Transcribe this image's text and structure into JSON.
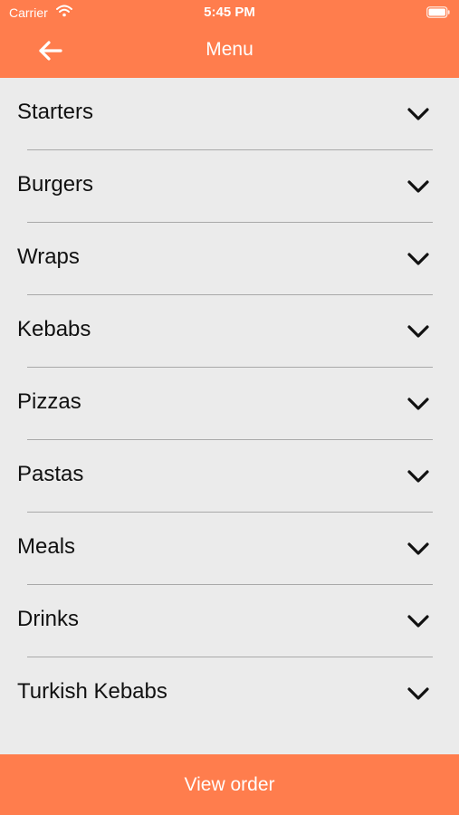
{
  "status_bar": {
    "carrier": "Carrier",
    "time": "5:45 PM",
    "wifi_icon": "wifi-icon",
    "battery_icon": "battery-icon"
  },
  "header": {
    "title": "Menu",
    "back_icon": "arrow-left-icon"
  },
  "menu": {
    "items": [
      {
        "label": "Starters",
        "icon": "chevron-down-icon"
      },
      {
        "label": "Burgers",
        "icon": "chevron-down-icon"
      },
      {
        "label": "Wraps",
        "icon": "chevron-down-icon"
      },
      {
        "label": "Kebabs",
        "icon": "chevron-down-icon"
      },
      {
        "label": "Pizzas",
        "icon": "chevron-down-icon"
      },
      {
        "label": "Pastas",
        "icon": "chevron-down-icon"
      },
      {
        "label": "Meals",
        "icon": "chevron-down-icon"
      },
      {
        "label": "Drinks",
        "icon": "chevron-down-icon"
      },
      {
        "label": "Turkish Kebabs",
        "icon": "chevron-down-icon"
      }
    ]
  },
  "footer": {
    "view_order_label": "View order"
  },
  "colors": {
    "accent": "#ff7d4d",
    "background": "#ebebeb",
    "text": "#111111",
    "separator": "#a9a9a9"
  }
}
